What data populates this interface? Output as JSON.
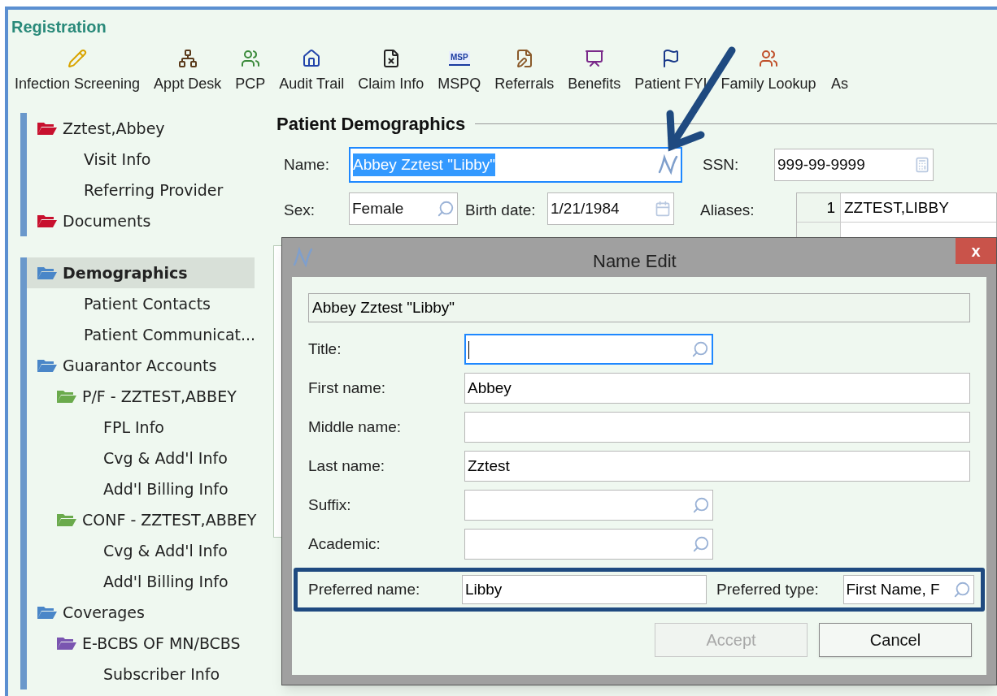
{
  "window": {
    "title": "Registration"
  },
  "toolbar": [
    {
      "label": "Infection Screening"
    },
    {
      "label": "Appt Desk"
    },
    {
      "label": "PCP"
    },
    {
      "label": "Audit Trail"
    },
    {
      "label": "Claim Info"
    },
    {
      "label": "MSPQ",
      "icon_text": "MSP"
    },
    {
      "label": "Referrals"
    },
    {
      "label": "Benefits"
    },
    {
      "label": "Patient FYI"
    },
    {
      "label": "Family Lookup"
    },
    {
      "label": "As"
    }
  ],
  "sidebar": {
    "groups": [
      {
        "items": [
          {
            "label": "Zztest,Abbey",
            "color": "#c8102e",
            "selected": false,
            "children": [
              {
                "label": "Visit Info",
                "selected": false
              },
              {
                "label": "Referring Provider",
                "selected": false
              }
            ]
          },
          {
            "label": "Documents",
            "color": "#c8102e",
            "selected": false
          }
        ]
      },
      {
        "items": [
          {
            "label": "Demographics",
            "color": "#4a86c8",
            "selected": true,
            "children": [
              {
                "label": "Patient Contacts",
                "selected": false
              },
              {
                "label": "Patient Communicat...",
                "selected": false
              }
            ]
          },
          {
            "label": "Guarantor Accounts",
            "color": "#4a86c8",
            "selected": false,
            "children": [
              {
                "label": "P/F - ZZTEST,ABBEY",
                "color": "#6aaa4c",
                "selected": false,
                "children": [
                  {
                    "label": "FPL Info",
                    "selected": false
                  },
                  {
                    "label": "Cvg & Add'l Info",
                    "selected": false
                  },
                  {
                    "label": "Add'l Billing Info",
                    "selected": false
                  }
                ]
              },
              {
                "label": "CONF - ZZTEST,ABBEY",
                "color": "#6aaa4c",
                "selected": false,
                "children": [
                  {
                    "label": "Cvg & Add'l Info",
                    "selected": false
                  },
                  {
                    "label": "Add'l Billing Info",
                    "selected": false
                  }
                ]
              }
            ]
          },
          {
            "label": "Coverages",
            "color": "#4a86c8",
            "selected": false,
            "children": [
              {
                "label": "E-BCBS OF MN/BCBS",
                "color": "#7a55b0",
                "selected": false,
                "children": [
                  {
                    "label": "Subscriber Info",
                    "selected": false
                  }
                ]
              }
            ]
          }
        ]
      }
    ]
  },
  "demographics": {
    "heading": "Patient Demographics",
    "name": {
      "label": "Name:",
      "value": "Abbey Zztest \"Libby\"",
      "selected": true
    },
    "ssn": {
      "label": "SSN:",
      "value": "999-99-9999"
    },
    "sex": {
      "label": "Sex:",
      "value": "Female"
    },
    "birth_date": {
      "label": "Birth date:",
      "value": "1/21/1984"
    },
    "aliases": {
      "label": "Aliases:",
      "rows": [
        {
          "number": "1",
          "value": "ZZTEST,LIBBY"
        },
        {}
      ]
    }
  },
  "dialog": {
    "title": "Name Edit",
    "close": "x",
    "summary": "Abbey Zztest \"Libby\"",
    "fields": [
      {
        "label": "Title:",
        "kind": "lookup",
        "focused": true
      },
      {
        "label": "First name:",
        "kind": "text",
        "value": "Abbey",
        "focused": false
      },
      {
        "label": "Middle name:",
        "kind": "text",
        "focused": false
      },
      {
        "label": "Last name:",
        "kind": "text",
        "value": "Zztest",
        "focused": false
      },
      {
        "label": "Suffix:",
        "kind": "lookup",
        "focused": false
      },
      {
        "label": "Academic:",
        "kind": "lookup",
        "focused": false
      }
    ],
    "preferred": {
      "name_label": "Preferred name:",
      "name_value": "Libby",
      "type_label": "Preferred type:",
      "type_value": "First Name, F"
    },
    "buttons": [
      {
        "label": "Accept",
        "disabled": true
      },
      {
        "label": "Cancel",
        "disabled": false
      }
    ]
  }
}
